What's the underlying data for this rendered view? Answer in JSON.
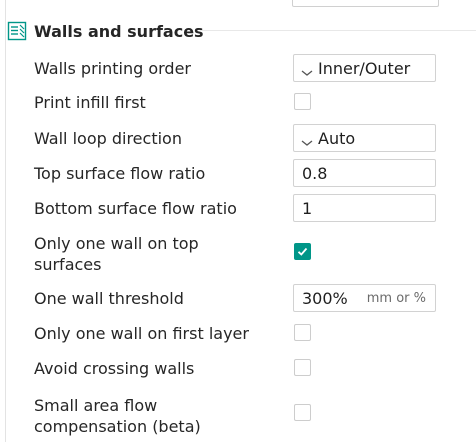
{
  "section": {
    "title": "Walls and surfaces",
    "icon": "walls-surfaces-icon"
  },
  "settings": {
    "walls_printing_order": {
      "label": "Walls printing order",
      "value": "Inner/Outer",
      "icon": "chevron-down-icon"
    },
    "print_infill_first": {
      "label": "Print infill first",
      "checked": false
    },
    "wall_loop_direction": {
      "label": "Wall loop direction",
      "value": "Auto",
      "icon": "chevron-down-icon"
    },
    "top_surface_flow_ratio": {
      "label": "Top surface flow ratio",
      "value": "0.8"
    },
    "bottom_surface_flow_ratio": {
      "label": "Bottom surface flow ratio",
      "value": "1"
    },
    "only_one_wall_top": {
      "label_line1": "Only one wall on top",
      "label_line2": "surfaces",
      "checked": true
    },
    "one_wall_threshold": {
      "label": "One wall threshold",
      "value": "300%",
      "unit": "mm or %"
    },
    "only_one_wall_first_layer": {
      "label": "Only one wall on first layer",
      "checked": false
    },
    "avoid_crossing_walls": {
      "label": "Avoid crossing walls",
      "checked": false
    },
    "small_area_flow_compensation": {
      "label_line1": "Small area flow",
      "label_line2": "compensation (beta)",
      "checked": false
    }
  },
  "colors": {
    "accent": "#009688",
    "border": "#d2d2d2",
    "text": "#262626"
  }
}
